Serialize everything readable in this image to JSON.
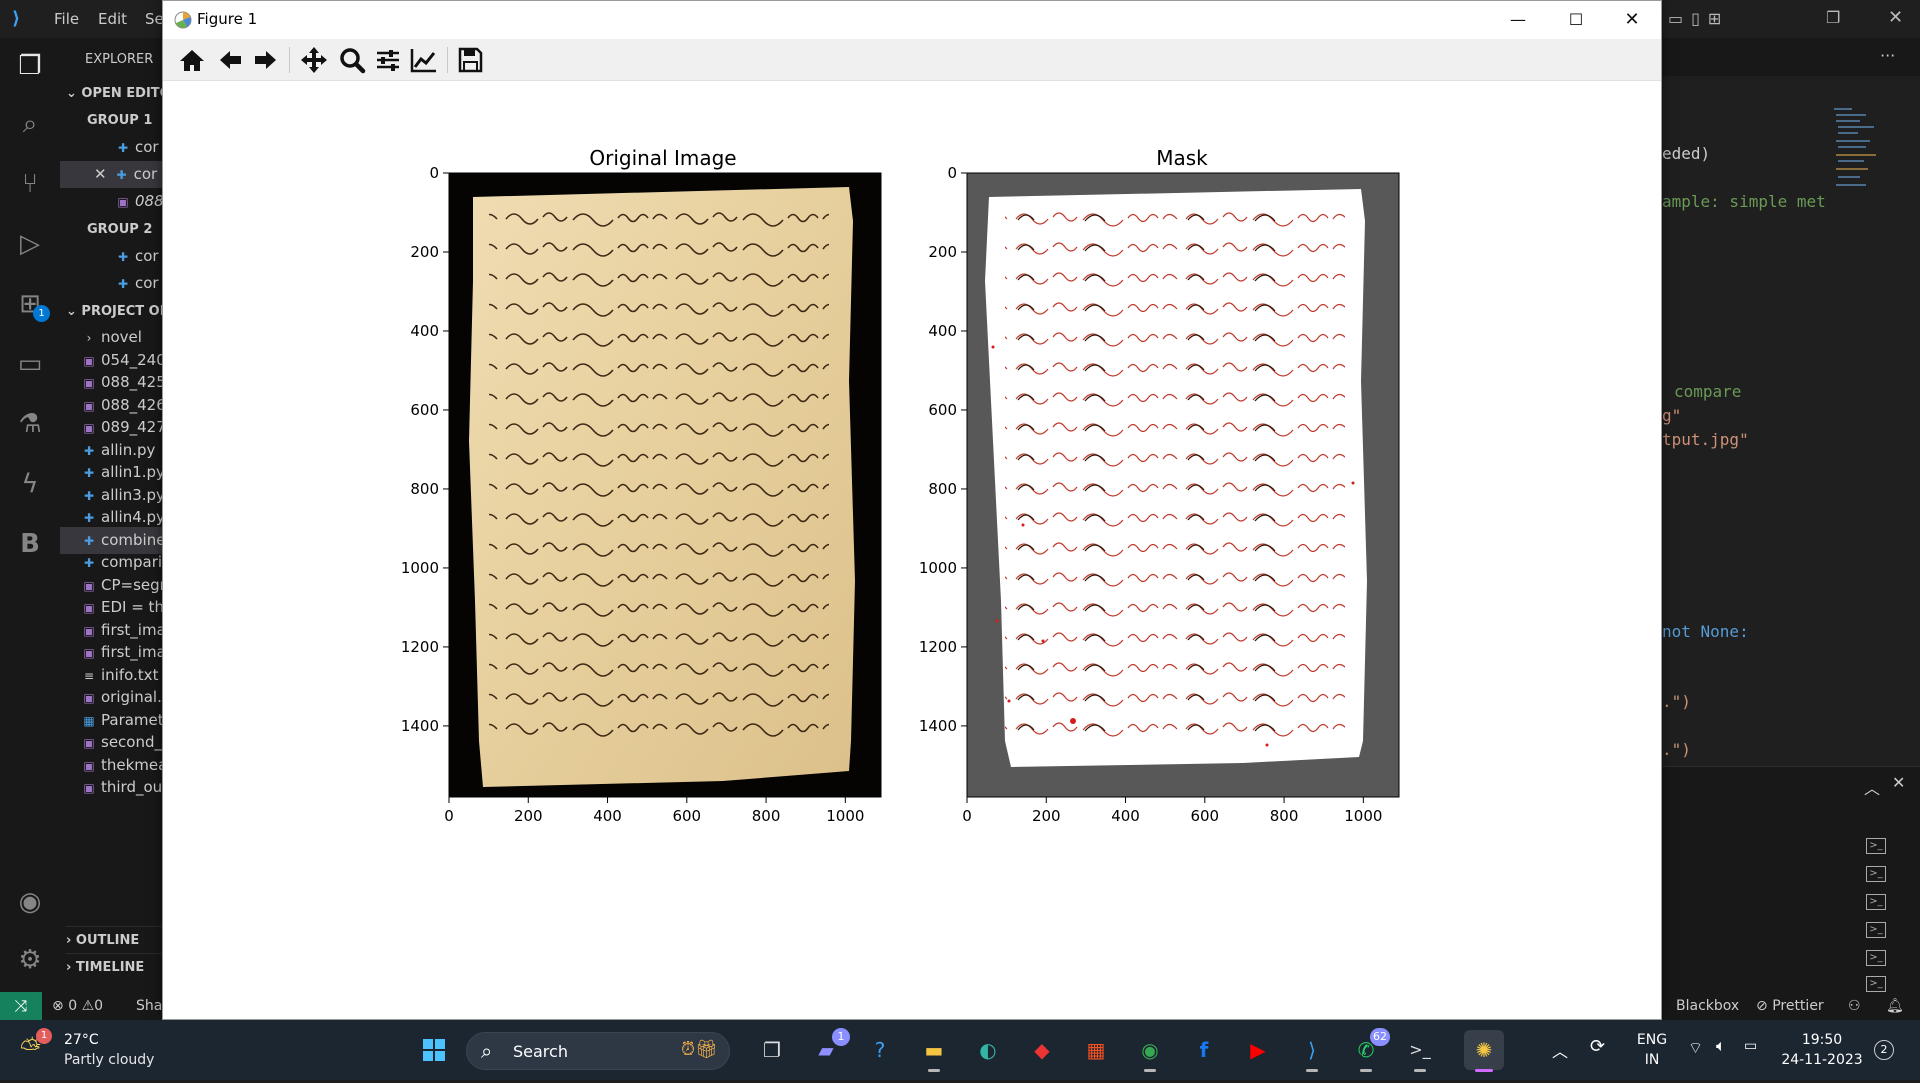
{
  "vscode": {
    "menu": [
      "File",
      "Edit",
      "Se"
    ],
    "sidebar": {
      "explorer_title": "EXPLORER",
      "open_editors": "OPEN EDITO",
      "group1": "GROUP 1",
      "group1_items": [
        "cor",
        "cor",
        "088"
      ],
      "group2": "GROUP 2",
      "group2_items": [
        "cor",
        "cor"
      ],
      "project": "PROJECT ON",
      "files": [
        "novel",
        "054_240",
        "088_425",
        "088_426",
        "089_427",
        "allin.py",
        "allin1.py",
        "allin3.py",
        "allin4.py",
        "combine",
        "compari",
        "CP=segr",
        "EDI = th",
        "first_ima",
        "first_ima",
        "inifo.txt",
        "original.",
        "Paramet",
        "second_",
        "thekmea",
        "third_ou"
      ],
      "outline": "OUTLINE",
      "timeline": "TIMELINE"
    },
    "editor_fragments": [
      "eded)",
      "ample: simple met",
      "compare",
      "g\"",
      "tput.jpg\"",
      "not None:",
      ".\")",
      ".\")"
    ],
    "statusbar": {
      "errors": "0",
      "warnings": "0",
      "left_text": "Sha",
      "blackbox": "Blackbox",
      "prettier": "Prettier"
    },
    "activity_badge": "1"
  },
  "figure": {
    "window_title": "Figure 1",
    "toolbar": [
      "home-icon",
      "back-icon",
      "forward-icon",
      "pan-icon",
      "zoom-icon",
      "configure-subplots-icon",
      "edit-axis-icon",
      "save-icon"
    ]
  },
  "chart_data": [
    {
      "type": "image",
      "title": "Original Image",
      "xticks": [
        0,
        200,
        400,
        600,
        800,
        1000
      ],
      "yticks": [
        0,
        200,
        400,
        600,
        800,
        1000,
        1200,
        1400
      ],
      "xlim": [
        0,
        1090
      ],
      "ylim": [
        1580,
        0
      ],
      "background": "#000000",
      "paper_color": "#e9d4a6"
    },
    {
      "type": "image",
      "title": "Mask",
      "xticks": [
        0,
        200,
        400,
        600,
        800,
        1000
      ],
      "yticks": [
        0,
        200,
        400,
        600,
        800,
        1000,
        1200,
        1400
      ],
      "xlim": [
        0,
        1090
      ],
      "ylim": [
        1580,
        0
      ],
      "background": "#585858",
      "paper_color": "#ffffff",
      "ink_color": "#d41c1c"
    }
  ],
  "taskbar": {
    "temperature": "27°C",
    "weather": "Partly cloudy",
    "weather_badge": "1",
    "search_label": "Search",
    "teams_badge": "1",
    "whatsapp_badge": "62",
    "language": [
      "ENG",
      "IN"
    ],
    "time": "19:50",
    "date": "24-11-2023",
    "notification_count": "2",
    "apps": [
      "windows-start-icon",
      "task-view-icon",
      "teams-icon",
      "help-icon",
      "file-explorer-icon",
      "edge-icon",
      "jewel-app-icon",
      "store-icon",
      "chrome-icon",
      "facebook-icon",
      "youtube-icon",
      "vscode-icon",
      "whatsapp-icon",
      "terminal-icon",
      "matplotlib-icon"
    ]
  }
}
